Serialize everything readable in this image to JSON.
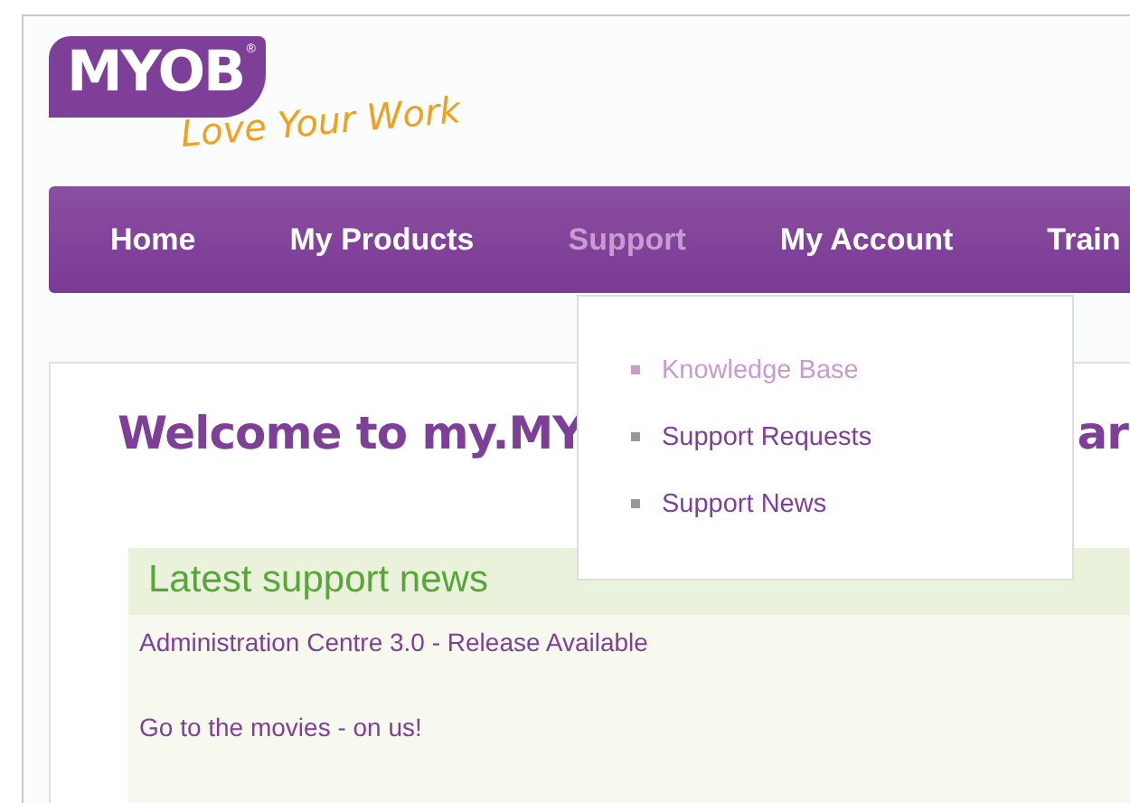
{
  "logo": {
    "wordmark": "MYOB",
    "registered": "®",
    "tagline": "Love Your Work"
  },
  "nav": [
    {
      "label": "Home",
      "selected": false
    },
    {
      "label": "My Products",
      "selected": false
    },
    {
      "label": "Support",
      "selected": true
    },
    {
      "label": "My Account",
      "selected": false
    },
    {
      "label": "Train",
      "selected": false
    }
  ],
  "dropdown": [
    {
      "label": "Knowledge Base",
      "selected": true
    },
    {
      "label": "Support Requests",
      "selected": false
    },
    {
      "label": "Support News",
      "selected": false
    }
  ],
  "heading": {
    "left": "Welcome to my.MY",
    "right": "ar"
  },
  "news": {
    "title": "Latest support news",
    "items": [
      "Administration Centre 3.0 - Release Available",
      "Go to the movies - on us!"
    ]
  }
}
